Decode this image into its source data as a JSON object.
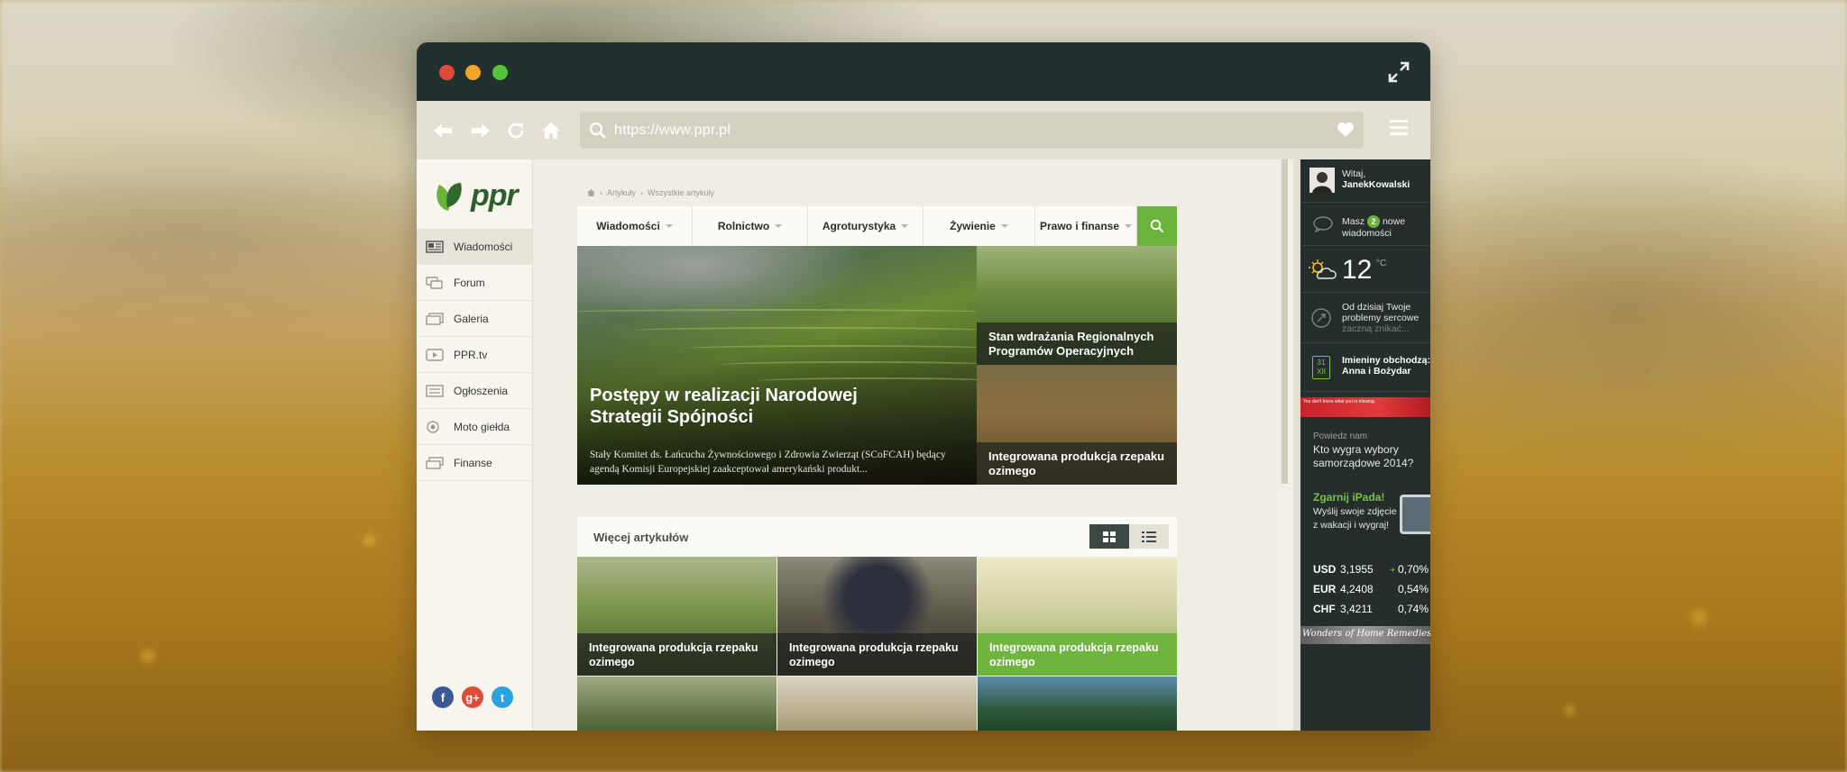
{
  "browser": {
    "url": "https://www.ppr.pl"
  },
  "logo": {
    "text": "ppr"
  },
  "sidebar": {
    "items": [
      {
        "label": "Wiadomości",
        "icon": "news-icon"
      },
      {
        "label": "Forum",
        "icon": "forum-icon"
      },
      {
        "label": "Galeria",
        "icon": "gallery-icon"
      },
      {
        "label": "PPR.tv",
        "icon": "video-icon"
      },
      {
        "label": "Ogłoszenia",
        "icon": "ads-icon"
      },
      {
        "label": "Moto giełda",
        "icon": "wheel-icon"
      },
      {
        "label": "Finanse",
        "icon": "finance-icon"
      }
    ],
    "social": {
      "facebook": "f",
      "googleplus": "g+",
      "twitter": "t"
    }
  },
  "breadcrumb": {
    "items": [
      "Artykuły",
      "Wszystkie artykuły"
    ]
  },
  "categories": [
    "Wiadomości",
    "Rolnictwo",
    "Agroturystyka",
    "Żywienie",
    "Prawo i finanse"
  ],
  "hero": {
    "main": {
      "title": "Postępy w realizacji Narodowej Strategii Spójności",
      "description": "Stały Komitet ds. Łańcucha Żywnościowego i Zdrowia Zwierząt (SCoFCAH) będący agendą Komisji Europejskiej zaakceptował amerykański produkt..."
    },
    "side": [
      {
        "title": "Stan wdrażania Regionalnych Programów Operacyjnych"
      },
      {
        "title": "Integrowana produkcja rzepaku ozimego"
      }
    ]
  },
  "more": {
    "title": "Więcej artykułów",
    "tiles": [
      {
        "title": "Integrowana produkcja rzepaku ozimego"
      },
      {
        "title": "Integrowana produkcja rzepaku ozimego"
      },
      {
        "title": "Integrowana produkcja rzepaku ozimego"
      }
    ]
  },
  "widgets": {
    "greeting": "Witaj,",
    "username": "JanekKowalski",
    "messages_prefix": "Masz",
    "messages_count": "2",
    "messages_suffix": "nowe wiadomości",
    "temperature": "12",
    "temperature_unit": "°C",
    "horoscope_line1": "Od dzisiaj Twoje",
    "horoscope_line2": "problemy sercowe",
    "horoscope_line3": "zaczną znikać...",
    "calendar_day": "31",
    "calendar_month": "XII",
    "nameday_label": "Imieniny obchodzą:",
    "nameday_names": "Anna i Bożydar",
    "ad_text": "You don't know what you're missing.",
    "poll_label": "Powiedz nam",
    "poll_question": "Kto wygra wybory samorządowe 2014?",
    "contest_title": "Zgarnij iPada!",
    "contest_text": "Wyślij swoje zdjęcie z wakacji i wygraj!",
    "currencies": [
      {
        "code": "USD",
        "rate": "3,1955",
        "change": "0,70%",
        "up": true
      },
      {
        "code": "EUR",
        "rate": "4,2408",
        "change": "0,54%",
        "up": false
      },
      {
        "code": "CHF",
        "rate": "3,4211",
        "change": "0,74%",
        "up": false
      }
    ],
    "ad2_text": "Wonders of Home Remedies"
  },
  "colors": {
    "accent": "#6bb43c",
    "titlebar": "#22302f",
    "widget_bg": "#262e2d"
  }
}
